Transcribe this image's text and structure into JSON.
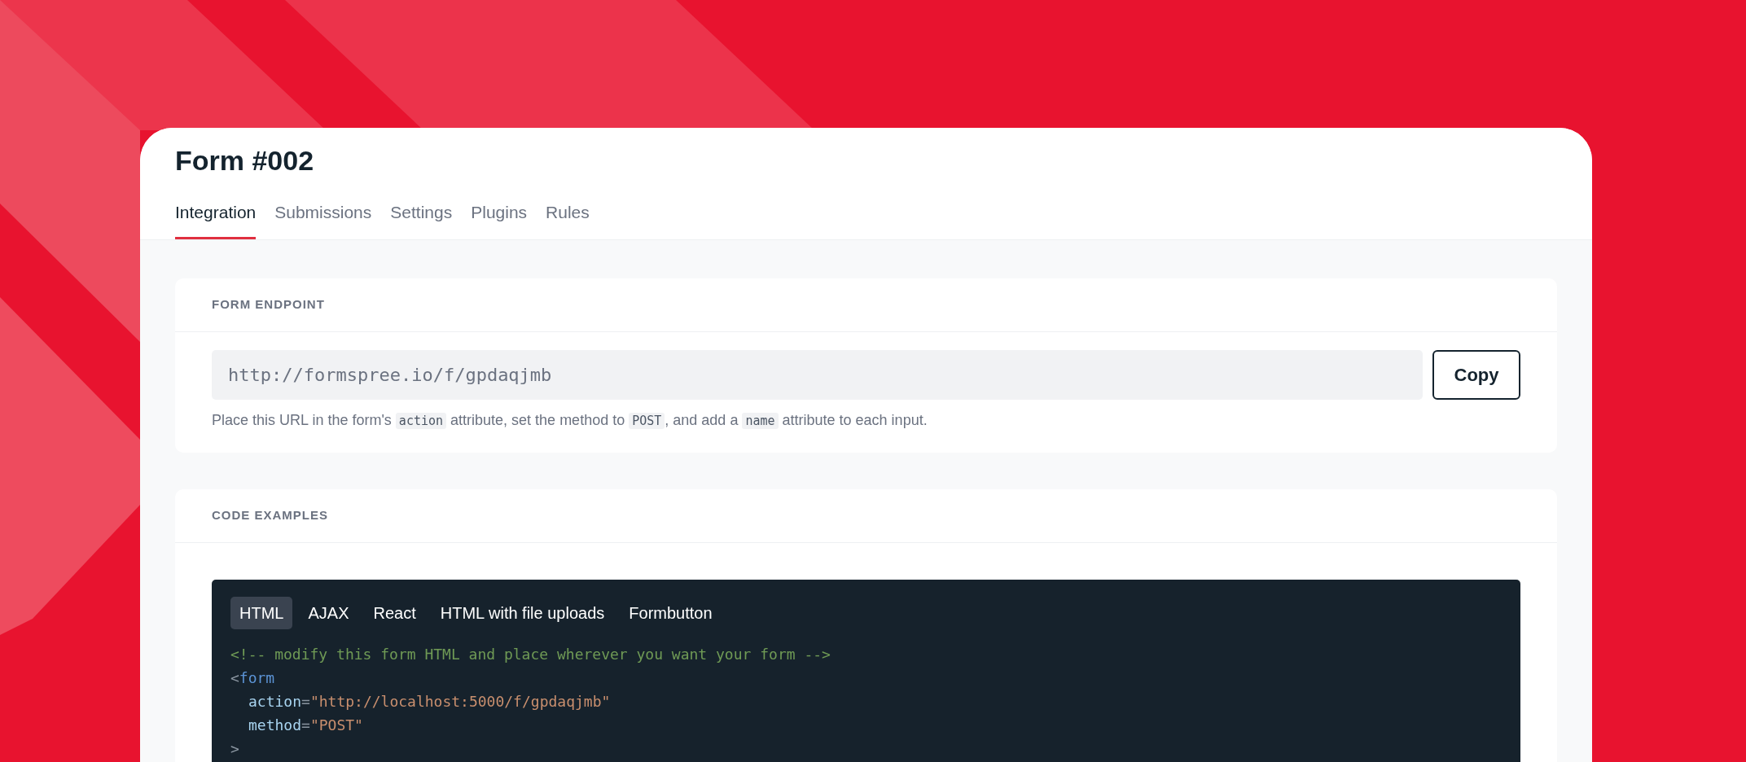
{
  "page": {
    "title": "Form #002"
  },
  "tabs": [
    {
      "label": "Integration",
      "selected": true
    },
    {
      "label": "Submissions",
      "selected": false
    },
    {
      "label": "Settings",
      "selected": false
    },
    {
      "label": "Plugins",
      "selected": false
    },
    {
      "label": "Rules",
      "selected": false
    }
  ],
  "endpoint": {
    "heading": "FORM ENDPOINT",
    "url": "http://formspree.io/f/gpdaqjmb",
    "copy_button": "Copy",
    "help": [
      {
        "kind": "text",
        "text": "Place this URL in the form's "
      },
      {
        "kind": "code",
        "text": "action"
      },
      {
        "kind": "text",
        "text": " attribute, set the method to "
      },
      {
        "kind": "code",
        "text": "POST"
      },
      {
        "kind": "text",
        "text": ", and add a "
      },
      {
        "kind": "code",
        "text": "name"
      },
      {
        "kind": "text",
        "text": " attribute to each input."
      }
    ]
  },
  "code_examples": {
    "heading": "CODE EXAMPLES",
    "tabs": [
      {
        "label": "HTML",
        "selected": true
      },
      {
        "label": "AJAX",
        "selected": false
      },
      {
        "label": "React",
        "selected": false
      },
      {
        "label": "HTML with file uploads",
        "selected": false
      },
      {
        "label": "Formbutton",
        "selected": false
      }
    ],
    "lines": [
      {
        "indent": false,
        "tokens": [
          {
            "kind": "comment",
            "text": "<!-- modify this form HTML and place wherever you want your form -->"
          }
        ]
      },
      {
        "indent": false,
        "tokens": [
          {
            "kind": "punct",
            "text": "<"
          },
          {
            "kind": "tag",
            "text": "form"
          }
        ]
      },
      {
        "indent": true,
        "tokens": [
          {
            "kind": "attr",
            "text": "action"
          },
          {
            "kind": "punct",
            "text": "="
          },
          {
            "kind": "string",
            "text": "\"http://localhost:5000/f/gpdaqjmb\""
          }
        ]
      },
      {
        "indent": true,
        "tokens": [
          {
            "kind": "attr",
            "text": "method"
          },
          {
            "kind": "punct",
            "text": "="
          },
          {
            "kind": "string",
            "text": "\"POST\""
          }
        ]
      },
      {
        "indent": false,
        "tokens": [
          {
            "kind": "punct",
            "text": ">"
          }
        ]
      }
    ]
  }
}
